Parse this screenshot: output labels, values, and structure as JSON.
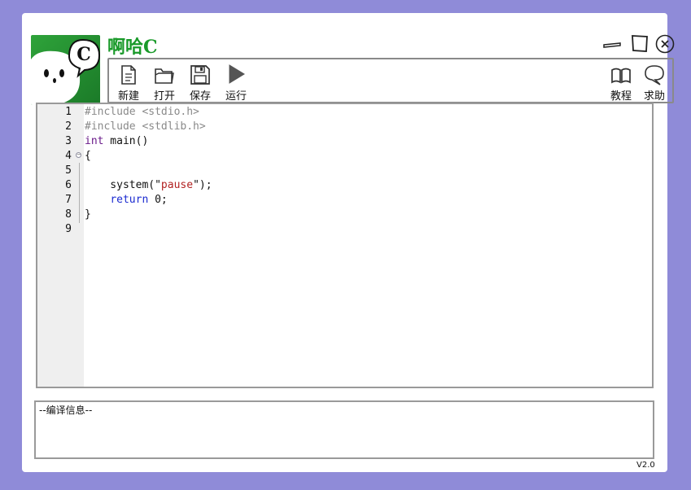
{
  "app": {
    "title": "啊哈C",
    "version": "V2.0",
    "logo_letter": "C"
  },
  "toolbar": {
    "left": [
      {
        "label": "新建",
        "icon": "new-file-icon"
      },
      {
        "label": "打开",
        "icon": "folder-open-icon"
      },
      {
        "label": "保存",
        "icon": "save-icon"
      },
      {
        "label": "运行",
        "icon": "play-icon"
      }
    ],
    "right": [
      {
        "label": "教程",
        "icon": "book-icon"
      },
      {
        "label": "求助",
        "icon": "speech-bubble-icon"
      }
    ]
  },
  "editor": {
    "lines": [
      {
        "n": "1",
        "text": "#include <stdio.h>"
      },
      {
        "n": "2",
        "text": "#include <stdlib.h>"
      },
      {
        "n": "3",
        "text": "int main()"
      },
      {
        "n": "4",
        "text": "{"
      },
      {
        "n": "5",
        "text": ""
      },
      {
        "n": "6",
        "text": "    system(\"pause\");"
      },
      {
        "n": "7",
        "text": "    return 0;"
      },
      {
        "n": "8",
        "text": "}"
      },
      {
        "n": "9",
        "text": ""
      }
    ]
  },
  "output": {
    "text": "--编译信息--"
  },
  "colors": {
    "background": "#8f8bd8",
    "title_green": "#1a9a2a",
    "preprocessor": "#8a8a8a",
    "keyword_int": "#6a1a8a",
    "keyword_return": "#1a2ad0",
    "string": "#b22222"
  }
}
